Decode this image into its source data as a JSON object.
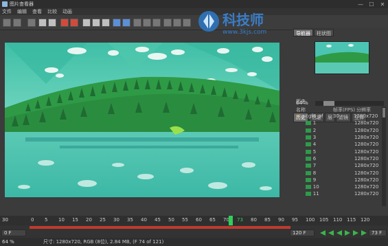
{
  "window": {
    "title": "图片查看器",
    "minimize": "—",
    "maximize": "☐",
    "close": "✕"
  },
  "menu": [
    "文件",
    "编辑",
    "查看",
    "比较",
    "动画"
  ],
  "watermark": {
    "line1": "科技师",
    "line2": "www.3kjs.com"
  },
  "navigator": {
    "tabs": [
      "导航器",
      "柱状图"
    ],
    "active_tab": 0,
    "zoom_label": "64 %",
    "zoom_fraction": 0.64
  },
  "panel_tabs": [
    "历史",
    "信息",
    "层",
    "滤镜",
    "立体"
  ],
  "history": {
    "heading": "历史",
    "columns": [
      "名称",
      "帧率(FPS)",
      "分辨率"
    ],
    "top": {
      "name": "cgf8_pf",
      "fps": "30",
      "res": "1280x720"
    },
    "frames": [
      {
        "name": "1",
        "res": "1280x720"
      },
      {
        "name": "2",
        "res": "1280x720"
      },
      {
        "name": "3",
        "res": "1280x720"
      },
      {
        "name": "4",
        "res": "1280x720"
      },
      {
        "name": "5",
        "res": "1280x720"
      },
      {
        "name": "6",
        "res": "1280x720"
      },
      {
        "name": "7",
        "res": "1280x720"
      },
      {
        "name": "8",
        "res": "1280x720"
      },
      {
        "name": "9",
        "res": "1280x720"
      },
      {
        "name": "10",
        "res": "1280x720"
      },
      {
        "name": "11",
        "res": "1280x720"
      }
    ]
  },
  "timeline": {
    "fps": "30",
    "ticks": [
      "0",
      "5",
      "10",
      "15",
      "20",
      "25",
      "30",
      "35",
      "40",
      "45",
      "50",
      "55",
      "60",
      "65",
      "70",
      "73",
      "80",
      "85",
      "90",
      "95",
      "100",
      "105",
      "110",
      "115",
      "120"
    ],
    "current_frame": "73",
    "current_frame_label": "73 F",
    "start_label": "0 F",
    "end_label": "120 F",
    "range_start": "0",
    "range_end": "120",
    "playhead_fraction": 0.608
  },
  "status": {
    "zoom": "64 %",
    "info": "尺寸: 1280x720, RGB (8位), 2.84 MB, (F 74 of 121)"
  },
  "colors": {
    "accent": "#2fcf5a",
    "range": "#c23a2f",
    "water": "#4cc4b4"
  }
}
